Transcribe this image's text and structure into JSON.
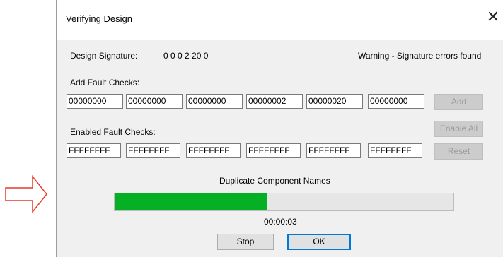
{
  "dialog": {
    "title": "Verifying Design",
    "close_glyph": "✕"
  },
  "signature": {
    "label": "Design Signature:",
    "value": "0 0 0 2 20 0",
    "warning": "Warning - Signature errors found"
  },
  "add_fault": {
    "label": "Add Fault Checks:",
    "fields": [
      "00000000",
      "00000000",
      "00000000",
      "00000002",
      "00000020",
      "00000000"
    ]
  },
  "enabled_fault": {
    "label": "Enabled Fault Checks:",
    "fields": [
      "FFFFFFFF",
      "FFFFFFFF",
      "FFFFFFFF",
      "FFFFFFFF",
      "FFFFFFFF",
      "FFFFFFFF"
    ]
  },
  "side_buttons": {
    "add": "Add",
    "enable_all": "Enable All",
    "reset": "Reset"
  },
  "progress": {
    "caption": "Duplicate Component Names",
    "fraction": 0.45,
    "fill_color": "#06b025",
    "elapsed": "00:00:03"
  },
  "buttons": {
    "stop": "Stop",
    "ok": "OK"
  },
  "annotation": {
    "arrow_icon": "right-arrow-outline",
    "arrow_color": "#e8392b"
  }
}
